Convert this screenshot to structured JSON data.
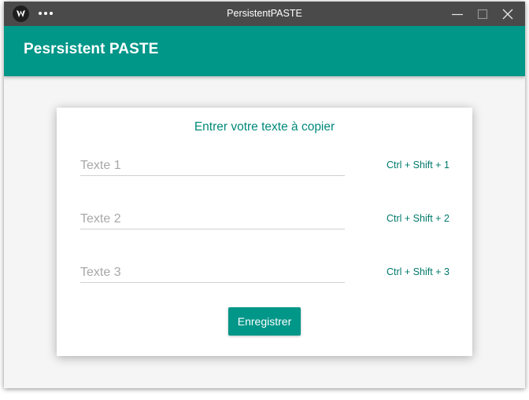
{
  "window": {
    "title": "PersistentPASTE",
    "controls": {
      "minimize_icon": "minimize-icon",
      "maximize_icon": "maximize-icon",
      "close_icon": "close-icon"
    }
  },
  "appbar": {
    "title": "Pesrsistent PASTE",
    "color": "#009688"
  },
  "form": {
    "heading": "Entrer votre texte à copier",
    "fields": [
      {
        "placeholder": "Texte 1",
        "value": "",
        "shortcut": "Ctrl + Shift + 1"
      },
      {
        "placeholder": "Texte 2",
        "value": "",
        "shortcut": "Ctrl + Shift + 2"
      },
      {
        "placeholder": "Texte 3",
        "value": "",
        "shortcut": "Ctrl + Shift + 3"
      }
    ],
    "save_label": "Enregistrer"
  },
  "colors": {
    "accent": "#009688",
    "titlebar": "#4a4a4a",
    "heading_text": "#00897b"
  }
}
